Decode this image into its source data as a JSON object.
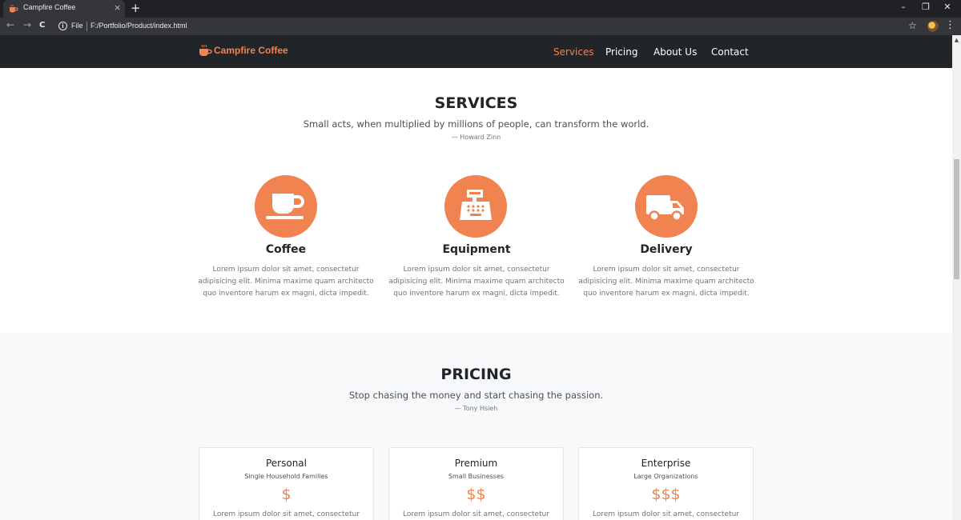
{
  "browser": {
    "tab_title": "Campfire Coffee",
    "tab_close": "×",
    "new_tab": "+",
    "file_label": "File",
    "url": "F:/Portfolio/Product/index.html",
    "minimize": "–",
    "restore": "❐",
    "close": "✕",
    "back": "←",
    "forward": "→",
    "reload": "C",
    "star": "☆",
    "menu": "⋮"
  },
  "nav": {
    "brand": "Campfire Coffee",
    "links": [
      {
        "label": "Services",
        "active": true
      },
      {
        "label": "Pricing"
      },
      {
        "label": "About Us"
      },
      {
        "label": "Contact"
      }
    ]
  },
  "services": {
    "title": "SERVICES",
    "quote": "Small acts, when multiplied by millions of people, can transform the world.",
    "cite": "— Howard Zinn",
    "items": [
      {
        "name": "Coffee",
        "icon": "coffee-cup-icon",
        "desc_lines": [
          "Lorem ipsum dolor sit amet, consectetur",
          "adipisicing elit. Minima maxime quam architecto",
          "quo inventore harum ex magni, dicta impedit."
        ]
      },
      {
        "name": "Equipment",
        "icon": "cash-register-icon",
        "desc_lines": [
          "Lorem ipsum dolor sit amet, consectetur",
          "adipisicing elit. Minima maxime quam architecto",
          "quo inventore harum ex magni, dicta impedit."
        ]
      },
      {
        "name": "Delivery",
        "icon": "delivery-truck-icon",
        "desc_lines": [
          "Lorem ipsum dolor sit amet, consectetur",
          "adipisicing elit. Minima maxime quam architecto",
          "quo inventore harum ex magni, dicta impedit."
        ]
      }
    ]
  },
  "pricing": {
    "title": "PRICING",
    "quote": "Stop chasing the money and start chasing the passion.",
    "cite": "— Tony Hsieh",
    "plans": [
      {
        "name": "Personal",
        "audience": "Single Household Families",
        "price": "$",
        "desc": "Lorem ipsum dolor sit amet, consectetur"
      },
      {
        "name": "Premium",
        "audience": "Small Businesses",
        "price": "$$",
        "desc": "Lorem ipsum dolor sit amet, consectetur"
      },
      {
        "name": "Enterprise",
        "audience": "Large Organizations",
        "price": "$$$",
        "desc": "Lorem ipsum dolor sit amet, consectetur"
      }
    ]
  },
  "colors": {
    "accent": "#f0834f",
    "navbar": "#212529",
    "chrome": "#202124"
  }
}
